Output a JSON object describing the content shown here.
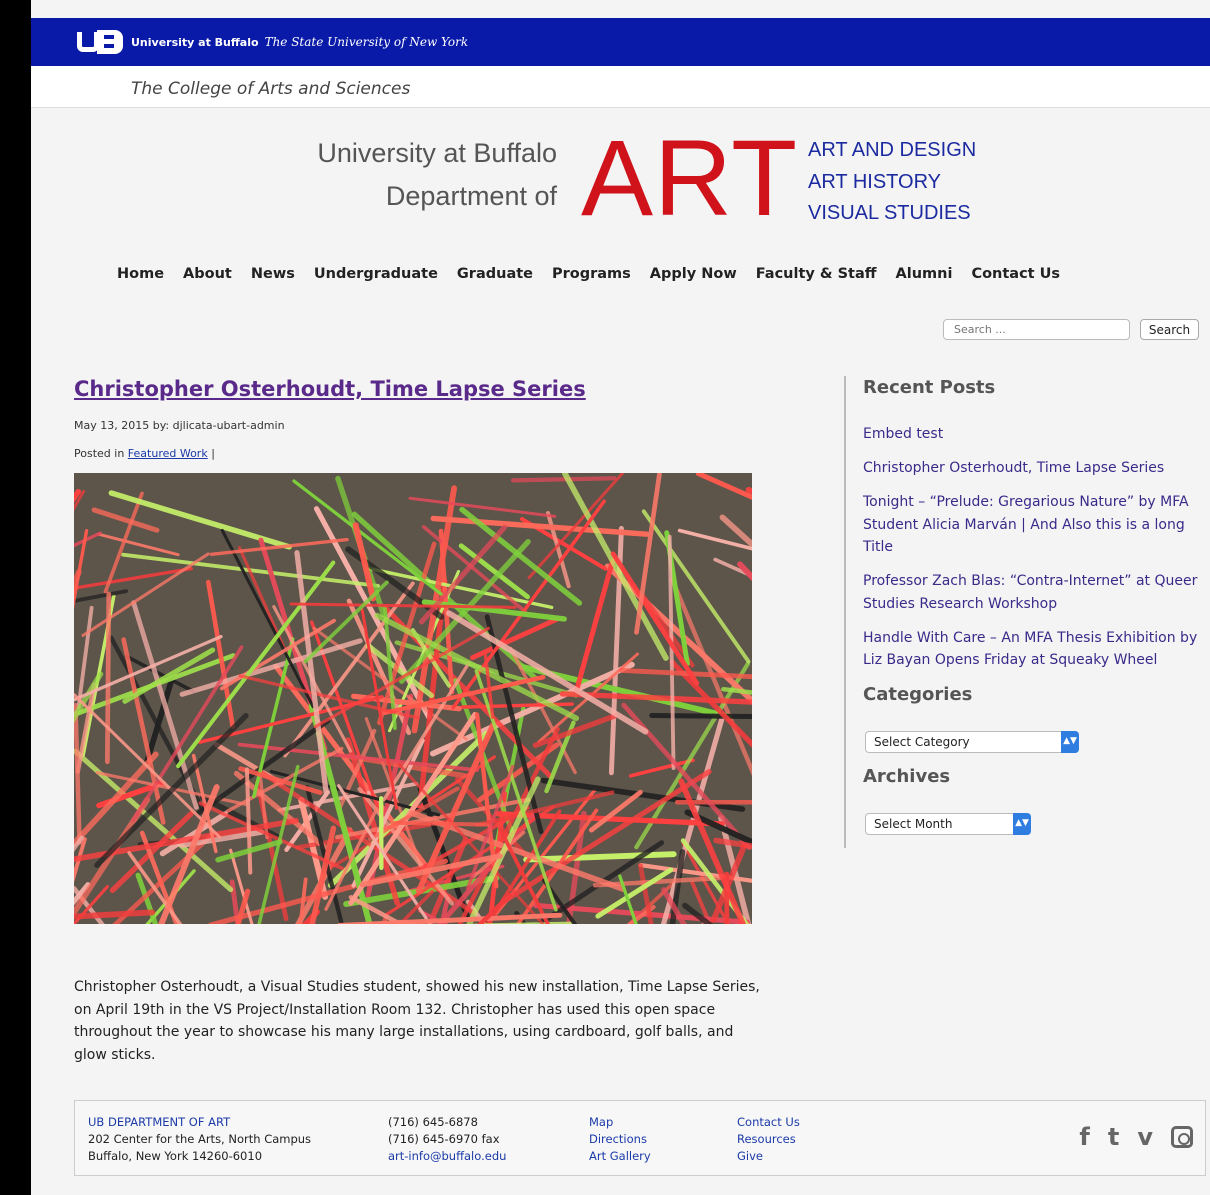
{
  "ub_bar": {
    "name": "University at Buffalo",
    "subtitle": "The State University of New York"
  },
  "college": "The College of Arts and Sciences",
  "dept": {
    "line1": "University at Buffalo",
    "line2": "Department of",
    "art": "ART",
    "programs": [
      "ART AND DESIGN",
      "ART HISTORY",
      "VISUAL STUDIES"
    ]
  },
  "nav": [
    "Home",
    "About",
    "News",
    "Undergraduate",
    "Graduate",
    "Programs",
    "Apply Now",
    "Faculty & Staff",
    "Alumni",
    "Contact Us"
  ],
  "search": {
    "placeholder": "Search ...",
    "button": "Search"
  },
  "post": {
    "title": "Christopher Osterhoudt, Time Lapse Series",
    "meta": "May 13, 2015  by: djlicata-ubart-admin",
    "posted_prefix": "Posted in ",
    "category": "Featured Work",
    "posted_suffix": " |",
    "body": "Christopher Osterhoudt, a Visual Studies student, showed his new installation, Time Lapse Series, on April 19th in the VS Project/Installation Room 132.  Christopher has used this open space throughout the year to showcase his many large installations, using cardboard, golf balls, and glow sticks."
  },
  "sidebar": {
    "recent_title": "Recent Posts",
    "recent": [
      "Embed test",
      "Christopher Osterhoudt, Time Lapse Series",
      "Tonight – “Prelude: Gregarious Nature” by MFA Student Alicia Marván | And Also this is a long Title",
      "Professor Zach Blas: “Contra-Internet” at Queer Studies Research Workshop",
      "Handle With Care – An MFA Thesis Exhibition by Liz Bayan Opens Friday at Squeaky Wheel"
    ],
    "categories_title": "Categories",
    "categories_select": "Select Category",
    "archives_title": "Archives",
    "archives_select": "Select Month"
  },
  "footer": {
    "col1": [
      "UB DEPARTMENT OF ART",
      "202 Center for the Arts, North Campus",
      "Buffalo, New York 14260-6010"
    ],
    "col2": [
      "(716) 645-6878",
      "(716) 645-6970 fax",
      "art-info@buffalo.edu"
    ],
    "col3": [
      "Map",
      "Directions",
      "Art Gallery"
    ],
    "col4": [
      "Contact Us",
      "Resources",
      "Give"
    ],
    "social": [
      "facebook-icon",
      "tumblr-icon",
      "vimeo-icon",
      "instagram-icon"
    ]
  },
  "colors": {
    "ub_blue": "#0a1aa8",
    "art_red": "#d0121b",
    "link_purple": "#5a2a8a"
  }
}
